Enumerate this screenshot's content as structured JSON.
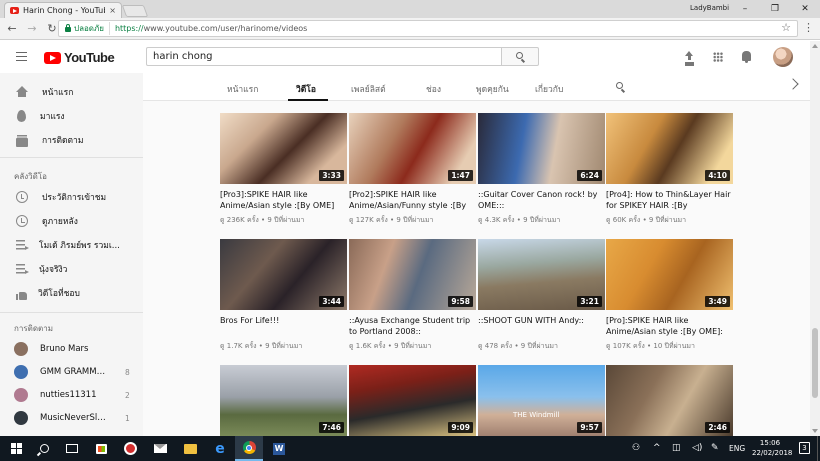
{
  "browser": {
    "tab_title": "Harin Chong - YouTube",
    "tab_close": "×",
    "window_user": "LadyBambi",
    "window_buttons": [
      "–",
      "❐",
      "✕"
    ],
    "nav": {
      "back": "←",
      "forward": "→",
      "reload": "↻"
    },
    "secure_label": "ปลอดภัย",
    "url_scheme": "https://",
    "url_rest": "www.youtube.com/user/harinome/videos",
    "star": "☆",
    "menu": "⋮"
  },
  "masthead": {
    "logo_text": "YouTube",
    "search_value": "harin chong",
    "icons": [
      "upload-icon",
      "apps-icon",
      "bell-icon",
      "avatar"
    ]
  },
  "sidebar": {
    "main": [
      {
        "label": "หน้าแรก",
        "icon": "home-icon"
      },
      {
        "label": "มาแรง",
        "icon": "trending-icon"
      },
      {
        "label": "การติดตาม",
        "icon": "subscriptions-icon"
      }
    ],
    "library_heading": "คลังวิดีโอ",
    "library": [
      {
        "label": "ประวัติการเข้าชม",
        "icon": "history-icon"
      },
      {
        "label": "ดูภายหลัง",
        "icon": "watch-later-icon"
      },
      {
        "label": "โมเด้ ภิรมย์พร รวมเ...",
        "icon": "playlist-icon"
      },
      {
        "label": "นุ้งจริงิว",
        "icon": "playlist-icon"
      },
      {
        "label": "วิดีโอที่ชอบ",
        "icon": "like-icon"
      }
    ],
    "subs_heading": "การติดตาม",
    "subscriptions": [
      {
        "name": "Bruno Mars",
        "count": "",
        "color": "#8a7060"
      },
      {
        "name": "GMM GRAMMY ...",
        "count": "8",
        "color": "#3f6fb0"
      },
      {
        "name": "nutties11311",
        "count": "2",
        "color": "#b07a90"
      },
      {
        "name": "MusicNeverSlee...",
        "count": "1",
        "color": "#303840"
      }
    ]
  },
  "channel_tabs": [
    "หน้าแรก",
    "วิดีโอ",
    "เพลย์ลิสต์",
    "ช่อง",
    "พูดคุยกัน",
    "เกี่ยวกับ"
  ],
  "videos": [
    {
      "title": "[Pro3]:SPIKE HAIR like Anime/Asian style :[By OME]",
      "meta": "ดู 236K ครั้ง • 9 ปีที่ผ่านมา",
      "duration": "3:33",
      "bg": "linear-gradient(135deg,#f0dcc6 0%,#c9a88e 30%,#4a2e24 55%,#d8b79c 80%)"
    },
    {
      "title": "[Pro2]:SPIKE HAIR like Anime/Asian/Funny style :[By",
      "meta": "ดู 127K ครั้ง • 9 ปีที่ผ่านมา",
      "duration": "1:47",
      "bg": "linear-gradient(120deg,#e8d2bc 0%,#b07a5c 35%,#8c2a1c 55%,#e6ccb2 85%)"
    },
    {
      "title": "::Guitar Cover Canon rock! by OME:::",
      "meta": "ดู 4.3K ครั้ง • 9 ปีที่ผ่านมา",
      "duration": "6:24",
      "bg": "linear-gradient(100deg,#2a2a3a 0%,#3c6ab0 35%,#d9c4b0 60%,#a08870 100%)"
    },
    {
      "title": "[Pro4]: How to Thin&Layer Hair for SPIKEY HAIR :[By",
      "meta": "ดู 60K ครั้ง • 9 ปีที่ผ่านมา",
      "duration": "4:10",
      "bg": "linear-gradient(120deg,#f1c27a 0%,#c88a3e 35%,#5a3a20 55%,#f3d79c 85%)"
    },
    {
      "title": "Bros For Life!!!",
      "meta": "ดู 1.7K ครั้ง • 9 ปีที่ผ่านมา",
      "duration": "3:44",
      "bg": "linear-gradient(130deg,#3a3a40 0%,#6e5a4e 35%,#2a2228 60%,#8e7a6a 100%)"
    },
    {
      "title": "::Ayusa Exchange Student trip to Portland 2008::",
      "meta": "ดู 1.6K ครั้ง • 9 ปีที่ผ่านมา",
      "duration": "9:58",
      "bg": "linear-gradient(110deg,#8a6a58 0%,#c8a088 30%,#5a6a80 55%,#b8a898 100%)"
    },
    {
      "title": "::SHOOT GUN WITH Andy::",
      "meta": "ดู 478 ครั้ง • 9 ปีที่ผ่านมา",
      "duration": "3:21",
      "bg": "linear-gradient(175deg,#c8d8e8 0%,#9aa8a0 35%,#8a7a62 60%,#6a5a48 100%)"
    },
    {
      "title": "[Pro]:SPIKE HAIR like Anime/Asian style :[By OME]:",
      "meta": "ดู 107K ครั้ง • 10 ปีที่ผ่านมา",
      "duration": "3:49",
      "bg": "linear-gradient(120deg,#e8a848 0%,#d88c30 35%,#a86420 60%,#f0c070 100%)"
    },
    {
      "title": "",
      "meta": "",
      "duration": "7:46",
      "bg": "linear-gradient(180deg,#c8ccd4 0%,#9aa0a8 45%,#5a6a40 70%,#7a8a58 100%)"
    },
    {
      "title": "",
      "meta": "",
      "duration": "9:09",
      "bg": "linear-gradient(170deg,#b02a22 0%,#7a2018 30%,#2a2a2a 60%,#d8c080 100%)"
    },
    {
      "title": "",
      "meta": "",
      "duration": "9:57",
      "bg": "linear-gradient(180deg,#5aa8e8 0%,#8ac0ec 45%,#d0b098 70%,#a08070 100%)",
      "overlay": "THE Windmill"
    },
    {
      "title": "",
      "meta": "",
      "duration": "2:46",
      "bg": "linear-gradient(120deg,#5a4838 0%,#8a7058 35%,#c8b090 60%,#4a3a2c 100%)"
    }
  ],
  "taskbar": {
    "lang": "ENG",
    "time": "15:06",
    "date": "22/02/2018",
    "notifications": "3",
    "apps": [
      "start-icon",
      "search-icon",
      "task-view-icon",
      "store-icon",
      "red-app-icon",
      "mail-icon",
      "explorer-icon",
      "edge-icon",
      "chrome-icon",
      "word-icon"
    ]
  }
}
